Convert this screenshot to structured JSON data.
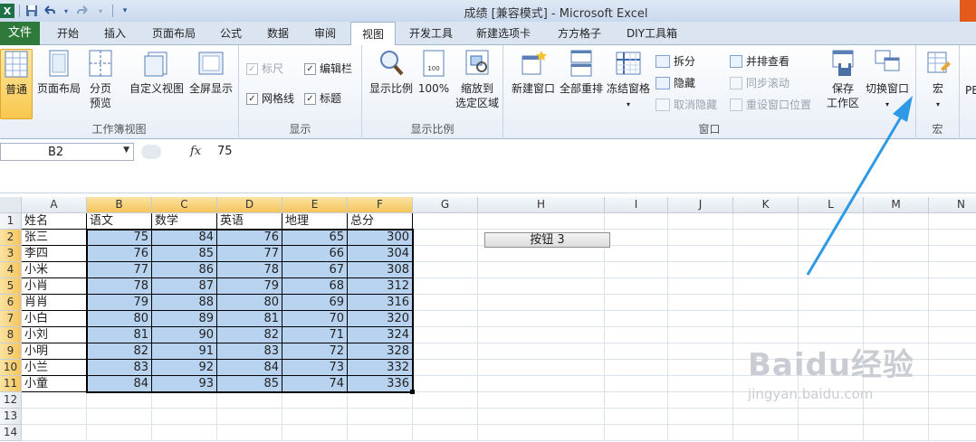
{
  "window": {
    "title": "成绩  [兼容模式]  -  Microsoft Excel"
  },
  "qat": {
    "icons": [
      "excel-logo-icon",
      "save-icon",
      "undo-icon",
      "redo-icon",
      "customize-icon"
    ]
  },
  "tabs": {
    "file": "文件",
    "items": [
      "开始",
      "插入",
      "页面布局",
      "公式",
      "数据",
      "审阅",
      "视图",
      "开发工具",
      "新建选项卡",
      "方方格子",
      "DIY工具箱"
    ],
    "active": "视图"
  },
  "ribbon": {
    "workbook_views": {
      "label": "工作簿视图",
      "normal": "普通",
      "page_layout": "页面布局",
      "page_break_1": "分页",
      "page_break_2": "预览",
      "custom_views": "自定义视图",
      "full_screen": "全屏显示"
    },
    "show": {
      "label": "显示",
      "ruler": "标尺",
      "formula_bar": "编辑栏",
      "gridlines": "网格线",
      "headings": "标题"
    },
    "zoom": {
      "label": "显示比例",
      "zoom": "显示比例",
      "hundred": "100%",
      "zoom_sel_1": "缩放到",
      "zoom_sel_2": "选定区域"
    },
    "window": {
      "label": "窗口",
      "new_window": "新建窗口",
      "arrange_all": "全部重排",
      "freeze_panes": "冻结窗格",
      "split": "拆分",
      "hide": "隐藏",
      "unhide": "取消隐藏",
      "side_by_side": "并排查看",
      "sync_scroll": "同步滚动",
      "reset_position": "重设窗口位置",
      "save_workspace_1": "保存",
      "save_workspace_2": "工作区",
      "switch_windows": "切换窗口"
    },
    "macros": {
      "label": "宏",
      "macros": "宏",
      "overflow": "PE"
    }
  },
  "formula_bar": {
    "name_box": "B2",
    "fx": "fx",
    "value": "75"
  },
  "sheet": {
    "columns": [
      "A",
      "B",
      "C",
      "D",
      "E",
      "F",
      "G",
      "H",
      "I",
      "J",
      "K",
      "L",
      "M",
      "N"
    ],
    "rows": [
      "1",
      "2",
      "3",
      "4",
      "5",
      "6",
      "7",
      "8",
      "9",
      "10",
      "11",
      "12",
      "13",
      "14"
    ],
    "headers": [
      "姓名",
      "语文",
      "数学",
      "英语",
      "地理",
      "总分"
    ],
    "data": [
      [
        "张三",
        "75",
        "84",
        "76",
        "65",
        "300"
      ],
      [
        "李四",
        "76",
        "85",
        "77",
        "66",
        "304"
      ],
      [
        "小米",
        "77",
        "86",
        "78",
        "67",
        "308"
      ],
      [
        "小肖",
        "78",
        "87",
        "79",
        "68",
        "312"
      ],
      [
        "肖肖",
        "79",
        "88",
        "80",
        "69",
        "316"
      ],
      [
        "小白",
        "80",
        "89",
        "81",
        "70",
        "320"
      ],
      [
        "小刘",
        "81",
        "90",
        "82",
        "71",
        "324"
      ],
      [
        "小明",
        "82",
        "91",
        "83",
        "72",
        "328"
      ],
      [
        "小兰",
        "83",
        "92",
        "84",
        "73",
        "332"
      ],
      [
        "小童",
        "84",
        "93",
        "85",
        "74",
        "336"
      ]
    ],
    "form_button": "按钮 3"
  },
  "watermark": {
    "line1": "Baidu经验",
    "line2": "jingyan.baidu.com"
  },
  "colors": {
    "file_tab": "#2f7a3b",
    "selection_fill": "#b8d3f0",
    "header_highlight": "#f5c55c",
    "arrow": "#2e9ae6"
  }
}
